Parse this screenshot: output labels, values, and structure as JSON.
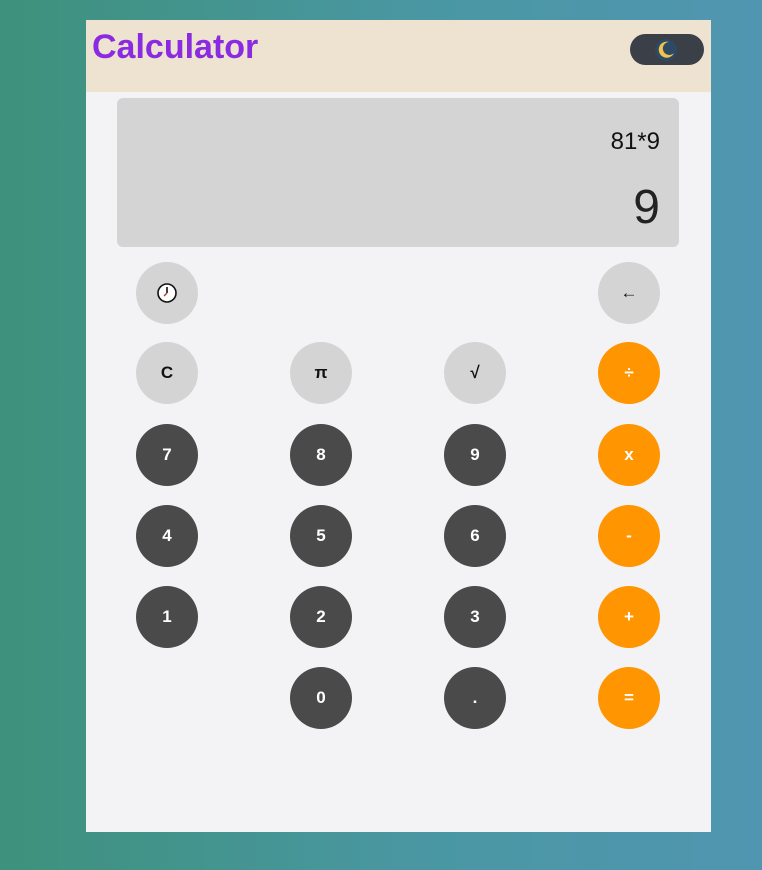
{
  "app": {
    "title": "Calculator",
    "theme_toggle_icon": "moon-icon"
  },
  "display": {
    "expression": "81*9",
    "result": "9"
  },
  "colors": {
    "title": "#8a2be2",
    "header_bg": "#ede3d0",
    "display_bg": "#d4d4d4",
    "light_button": "#d4d4d4",
    "dark_button": "#4a4a4a",
    "operator_button": "#ff9500",
    "toggle_bg": "#3b3f48"
  },
  "buttons": {
    "history_icon": "history-icon",
    "backspace": "←",
    "clear": "C",
    "pi": "π",
    "sqrt": "√",
    "divide": "÷",
    "seven": "7",
    "eight": "8",
    "nine": "9",
    "multiply": "x",
    "four": "4",
    "five": "5",
    "six": "6",
    "subtract": "-",
    "one": "1",
    "two": "2",
    "three": "3",
    "add": "+",
    "zero": "0",
    "decimal": ".",
    "equals": "="
  }
}
